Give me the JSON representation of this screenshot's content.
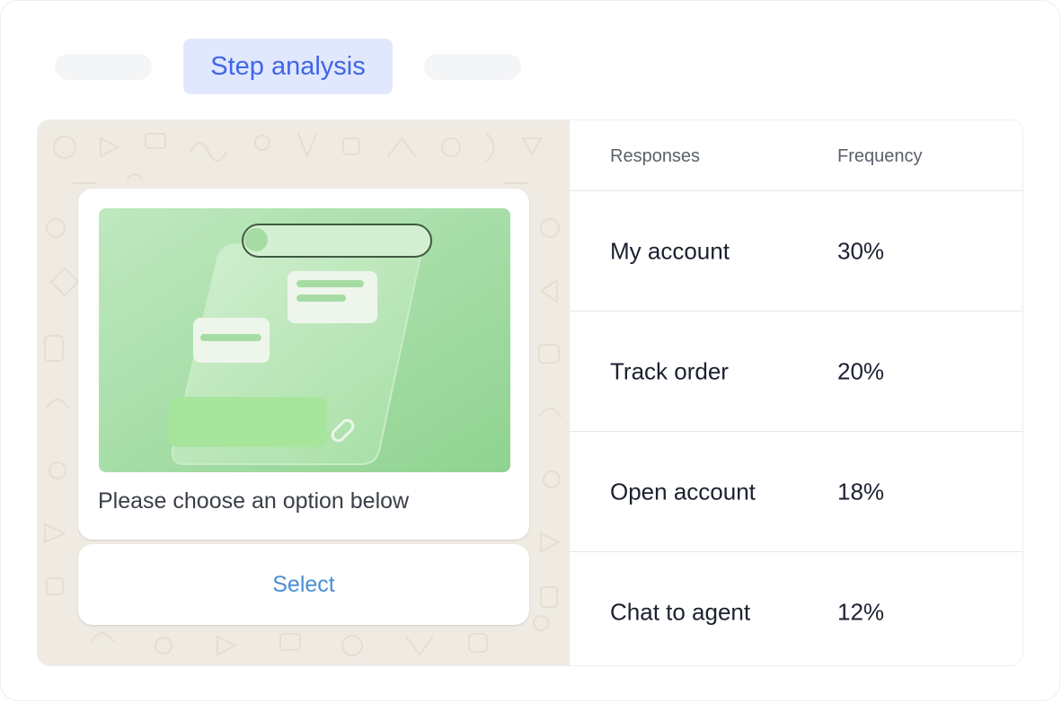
{
  "tabs": {
    "active_label": "Step analysis"
  },
  "chat": {
    "message_text": "Please choose an option below",
    "button_label": "Select",
    "image_icon": "chat-illustration-icon"
  },
  "table": {
    "headers": [
      "Responses",
      "Frequency"
    ],
    "rows": [
      {
        "response": "My account",
        "frequency": "30%"
      },
      {
        "response": "Track order",
        "frequency": "20%"
      },
      {
        "response": "Open account",
        "frequency": "18%"
      },
      {
        "response": "Chat to agent",
        "frequency": "12%"
      }
    ]
  },
  "colors": {
    "accent": "#3f65e8",
    "accent_bg": "#e1e8fd",
    "chat_background": "#efebe3",
    "button_text": "#4a8fd6",
    "illustration_green": "#8fd390"
  }
}
